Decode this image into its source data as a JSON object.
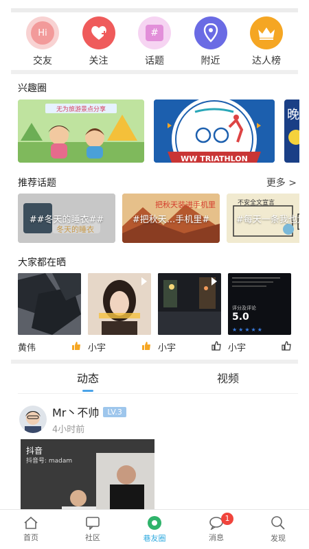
{
  "quick_nav": [
    {
      "label": "交友",
      "icon": "hi-icon",
      "color": "#f7c4c4"
    },
    {
      "label": "关注",
      "icon": "heart-plus-icon",
      "color": "#ef5b5b"
    },
    {
      "label": "话题",
      "icon": "hashtag-icon",
      "color": "#f3c8ef"
    },
    {
      "label": "附近",
      "icon": "location-pin-icon",
      "color": "#6a6be4"
    },
    {
      "label": "达人榜",
      "icon": "crown-icon",
      "color": "#f5a623"
    }
  ],
  "interest": {
    "title": "兴趣圈",
    "cards": [
      {
        "text": "无为旅游景点分享"
      },
      {
        "text": "WW TRIATHLON"
      },
      {
        "text": "晚"
      }
    ]
  },
  "topics": {
    "title": "推荐话题",
    "more": "更多 >",
    "items": [
      {
        "text": "##冬天的睡衣##",
        "sub": "冬天的睡衣"
      },
      {
        "text": "#把秋天...手机里#",
        "sub": "把秋天装进手机里"
      },
      {
        "text": "#每天一条我也太...",
        "sub": "不安全文宣言"
      }
    ]
  },
  "showcase": {
    "title": "大家都在晒",
    "items": [
      {
        "name": "黄伟",
        "liked": true
      },
      {
        "name": "小宇",
        "liked": true
      },
      {
        "name": "小宇",
        "liked": false
      },
      {
        "name": "小宇",
        "liked": false
      }
    ],
    "score_label": "评分及评论",
    "score_value": "5.0"
  },
  "tabs": [
    {
      "label": "动态",
      "active": true
    },
    {
      "label": "视频",
      "active": false
    }
  ],
  "post": {
    "author": "Mr丶不帅",
    "level": "LV.3",
    "time": "4小时前",
    "video_brand": "抖音",
    "video_sub": "抖音号: madam"
  },
  "bottom_nav": [
    {
      "label": "首页",
      "icon": "home-icon",
      "active": false
    },
    {
      "label": "社区",
      "icon": "community-icon",
      "active": false
    },
    {
      "label": "巷友圈",
      "icon": "circle-icon",
      "active": true
    },
    {
      "label": "消息",
      "icon": "message-icon",
      "active": false,
      "badge": "1"
    },
    {
      "label": "发现",
      "icon": "search-icon",
      "active": false
    }
  ],
  "colors": {
    "accent": "#2ea9df",
    "badge": "#f0443c",
    "level": "#9ec6ec"
  }
}
